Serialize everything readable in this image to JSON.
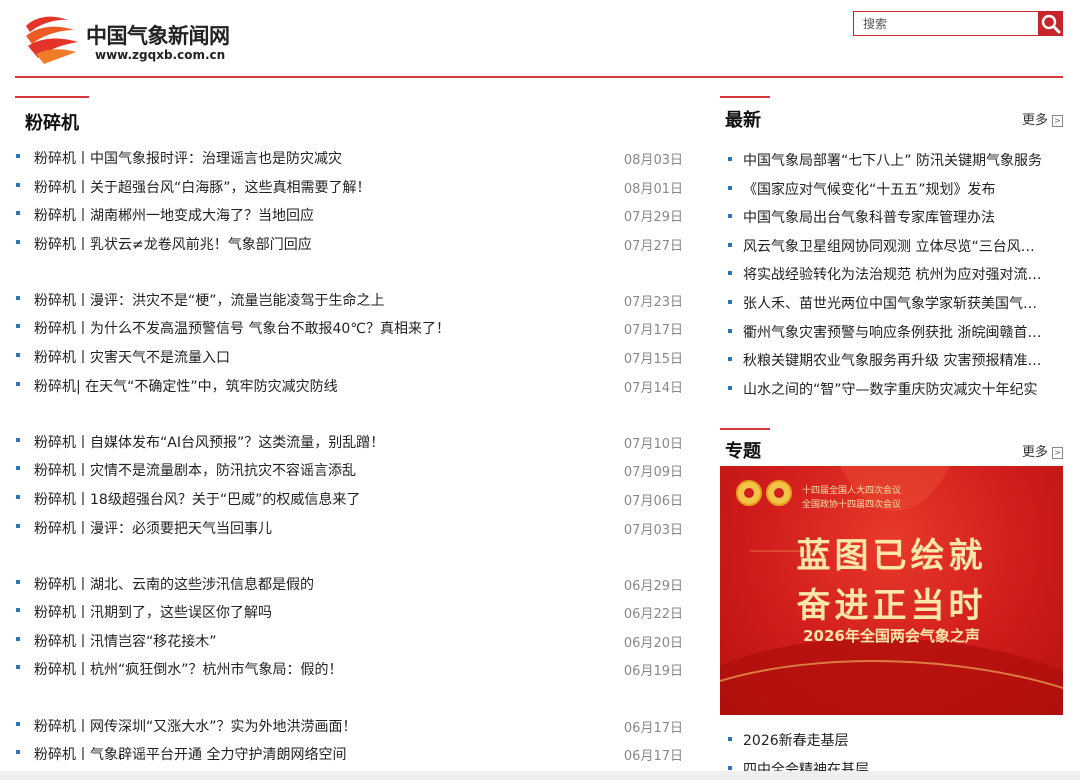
{
  "header": {
    "logo_cn": "中国气象新闻网",
    "logo_url": "www.zgqxb.com.cn",
    "search_placeholder": "搜索"
  },
  "left": {
    "title": "粉碎机",
    "items": [
      {
        "title": "粉碎机丨中国气象报时评：治理谣言也是防灾减灾",
        "date": "08月03日"
      },
      {
        "title": "粉碎机丨关于超强台风“白海豚”，这些真相需要了解！",
        "date": "08月01日"
      },
      {
        "title": "粉碎机丨湖南郴州一地变成大海了？当地回应",
        "date": "07月29日"
      },
      {
        "title": "粉碎机丨乳状云≠龙卷风前兆！气象部门回应",
        "date": "07月27日"
      },
      {
        "title": "粉碎机丨漫评：洪灾不是“梗”，流量岂能凌驾于生命之上",
        "date": "07月23日"
      },
      {
        "title": "粉碎机丨为什么不发高温预警信号 气象台不敢报40℃？真相来了！",
        "date": "07月17日"
      },
      {
        "title": "粉碎机丨灾害天气不是流量入口",
        "date": "07月15日"
      },
      {
        "title": "粉碎机| 在天气“不确定性”中，筑牢防灾减灾防线",
        "date": "07月14日"
      },
      {
        "title": "粉碎机丨自媒体发布“AI台风预报”？这类流量，别乱蹭！",
        "date": "07月10日"
      },
      {
        "title": "粉碎机丨灾情不是流量剧本，防汛抗灾不容谣言添乱",
        "date": "07月09日"
      },
      {
        "title": "粉碎机丨18级超强台风？关于“巴威”的权威信息来了",
        "date": "07月06日"
      },
      {
        "title": "粉碎机丨漫评：必须要把天气当回事儿",
        "date": "07月03日"
      },
      {
        "title": "粉碎机丨湖北、云南的这些涉汛信息都是假的",
        "date": "06月29日"
      },
      {
        "title": "粉碎机丨汛期到了，这些误区你了解吗",
        "date": "06月22日"
      },
      {
        "title": "粉碎机丨汛情岂容“移花接木”",
        "date": "06月20日"
      },
      {
        "title": "粉碎机丨杭州“疯狂倒水”？杭州市气象局：假的！",
        "date": "06月19日"
      },
      {
        "title": "粉碎机丨网传深圳“又涨大水”？实为外地洪涝画面！",
        "date": "06月17日"
      },
      {
        "title": "粉碎机丨气象辟谣平台开通 全力守护清朗网络空间",
        "date": "06月17日"
      }
    ]
  },
  "latest": {
    "title": "最新",
    "more": "更多",
    "items": [
      "中国气象局部署“七下八上” 防汛关键期气象服务",
      "《国家应对气候变化“十五五”规划》发布",
      "中国气象局出台气象科普专家库管理办法",
      "风云气象卫星组网协同观测 立体尽览“三台风共舞”",
      "将实战经验转化为法治规范 杭州为应对强对流天气立法",
      "张人禾、苗世光两位中国气象学家斩获美国气象学会奖项",
      "衢州气象灾害预警与响应条例获批 浙皖闽赣首部地方性法规",
      "秋粮关键期农业气象服务再升级 灾害预报精准到田",
      "山水之间的“智”守—数字重庆防灾减灾十年纪实"
    ]
  },
  "special": {
    "title": "专题",
    "more": "更多",
    "banner": {
      "header1": "十四届全国人大四次会议",
      "header2": "全国政协十四届四次会议",
      "line1": "蓝图已绘就",
      "line2": "奋进正当时",
      "subtitle": "2026年全国两会气象之声"
    },
    "items": [
      "2026新春走基层",
      "四中全会精神在基层"
    ]
  }
}
